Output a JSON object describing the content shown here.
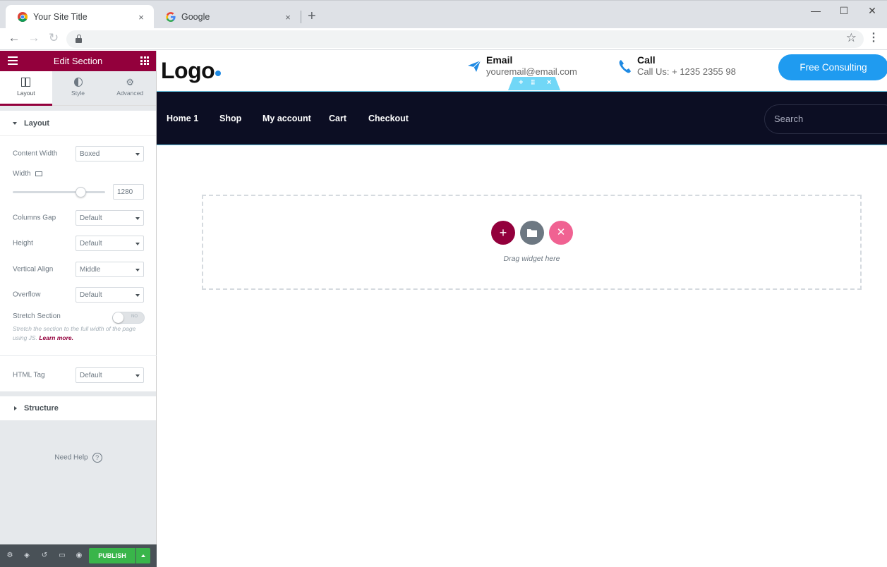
{
  "browser": {
    "tabs": [
      {
        "title": "Your Site Title",
        "icon": "chrome-icon"
      },
      {
        "title": "Google",
        "icon": "google-icon"
      }
    ],
    "close_glyph": "×",
    "new_tab_glyph": "+",
    "window_controls": {
      "minimize": "—",
      "maximize": "☐",
      "close": "✕"
    },
    "nav": {
      "back": "←",
      "forward": "→",
      "reload": "↻"
    },
    "bookmark_glyph": "☆",
    "menu_glyph": "⋮"
  },
  "panel": {
    "title": "Edit Section",
    "tabs": [
      {
        "label": "Layout",
        "icon": "layout-icon",
        "active": true
      },
      {
        "label": "Style",
        "icon": "style-icon",
        "active": false
      },
      {
        "label": "Advanced",
        "icon": "gear-icon",
        "active": false
      }
    ],
    "layout_section": {
      "heading": "Layout",
      "content_width": {
        "label": "Content Width",
        "value": "Boxed"
      },
      "width": {
        "label": "Width",
        "value": "1280",
        "slider_fraction": 0.73
      },
      "columns_gap": {
        "label": "Columns Gap",
        "value": "Default"
      },
      "height": {
        "label": "Height",
        "value": "Default"
      },
      "vertical_align": {
        "label": "Vertical Align",
        "value": "Middle"
      },
      "overflow": {
        "label": "Overflow",
        "value": "Default"
      },
      "stretch_section": {
        "label": "Stretch Section",
        "toggle_text": "NO",
        "description": "Stretch the section to the full width of the page using JS.",
        "learn_more": "Learn more."
      }
    },
    "html_tag": {
      "label": "HTML Tag",
      "value": "Default"
    },
    "structure_heading": "Structure",
    "need_help": "Need Help",
    "help_glyph": "?",
    "footer": {
      "publish_label": "PUBLISH"
    }
  },
  "site": {
    "logo": "Logo",
    "email": {
      "title": "Email",
      "value": "youremail@email.com"
    },
    "call": {
      "title": "Call",
      "value": "Call Us: + 1235 2355 98"
    },
    "cta_label": "Free Consulting",
    "nav_items": [
      "Home 1",
      "Shop",
      "My account",
      "Cart",
      "Checkout"
    ],
    "search_placeholder": "Search",
    "section_handles": {
      "add": "+",
      "move": "⠿",
      "delete": "×"
    },
    "dropzone": {
      "text": "Drag widget here",
      "add": "+",
      "template": "folder-icon",
      "close": "✕"
    }
  },
  "colors": {
    "panel_accent": "#93003c",
    "brand_blue": "#1f9bf0",
    "nav_bg": "#0c0e23",
    "publish_green": "#39b54a",
    "handle_cyan": "#71d7f7"
  }
}
